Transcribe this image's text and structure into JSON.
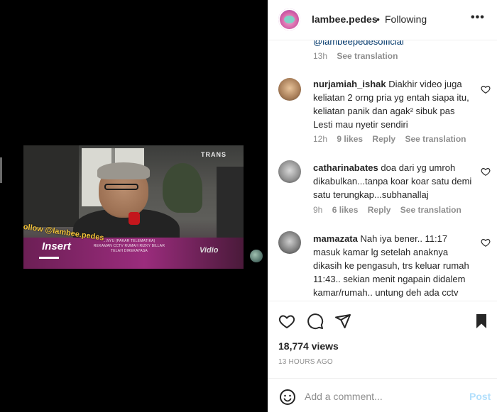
{
  "video": {
    "watermark": "Follow @lambee.pedes",
    "broadcaster_logo": "TRANS",
    "program_logo": "Insert",
    "caption_line1": "...NYU (PAKAR TELEMATIKA)",
    "caption_line2": "REKAMAN CCTV RUMAH RIZKY BILLAR",
    "caption_line3": "TELAH DIREKAYASA",
    "streaming_logo": "Vidio"
  },
  "header": {
    "username": "lambee.pedes",
    "separator": "•",
    "follow_status": "Following",
    "more_icon": "more-options-icon"
  },
  "comments": {
    "cut_text": "@lambeepedesofficial",
    "top_meta": {
      "time": "13h",
      "translate": "See translation"
    },
    "items": [
      {
        "username": "nurjamiah_ishak",
        "text": "Diakhir video juga keliatan 2 orng pria yg entah siapa itu, keliatan panik dan agak² sibuk pas Lesti mau nyetir sendiri",
        "time": "12h",
        "likes": "9 likes",
        "reply": "Reply",
        "translate": "See translation"
      },
      {
        "username": "catharinabates",
        "text": "doa dari yg umroh dikabulkan...tanpa koar koar satu demi satu terungkap...subhanallaj",
        "time": "9h",
        "likes": "6 likes",
        "reply": "Reply",
        "translate": "See translation"
      },
      {
        "username": "mamazata",
        "text": "Nah iya bener.. 11:17 masuk kamar lg setelah anaknya dikasih ke pengasuh, trs keluar rumah 11:43.. sekian menit ngapain didalem kamar/rumah.. untung deh ada cctv jadi ketahuan semuanya",
        "time": "",
        "likes": "",
        "reply": "",
        "translate": ""
      }
    ]
  },
  "actions": {
    "icons": [
      "heart-icon",
      "comment-icon",
      "share-icon",
      "bookmark-icon"
    ],
    "views": "18,774 views",
    "time_ago": "13 HOURS AGO"
  },
  "add_comment": {
    "placeholder": "Add a comment...",
    "post_label": "Post",
    "emoji_icon": "emoji-icon"
  },
  "colors": {
    "link_blue_disabled": "#b2dffc",
    "text_primary": "#262626",
    "text_secondary": "#8e8e8e"
  }
}
